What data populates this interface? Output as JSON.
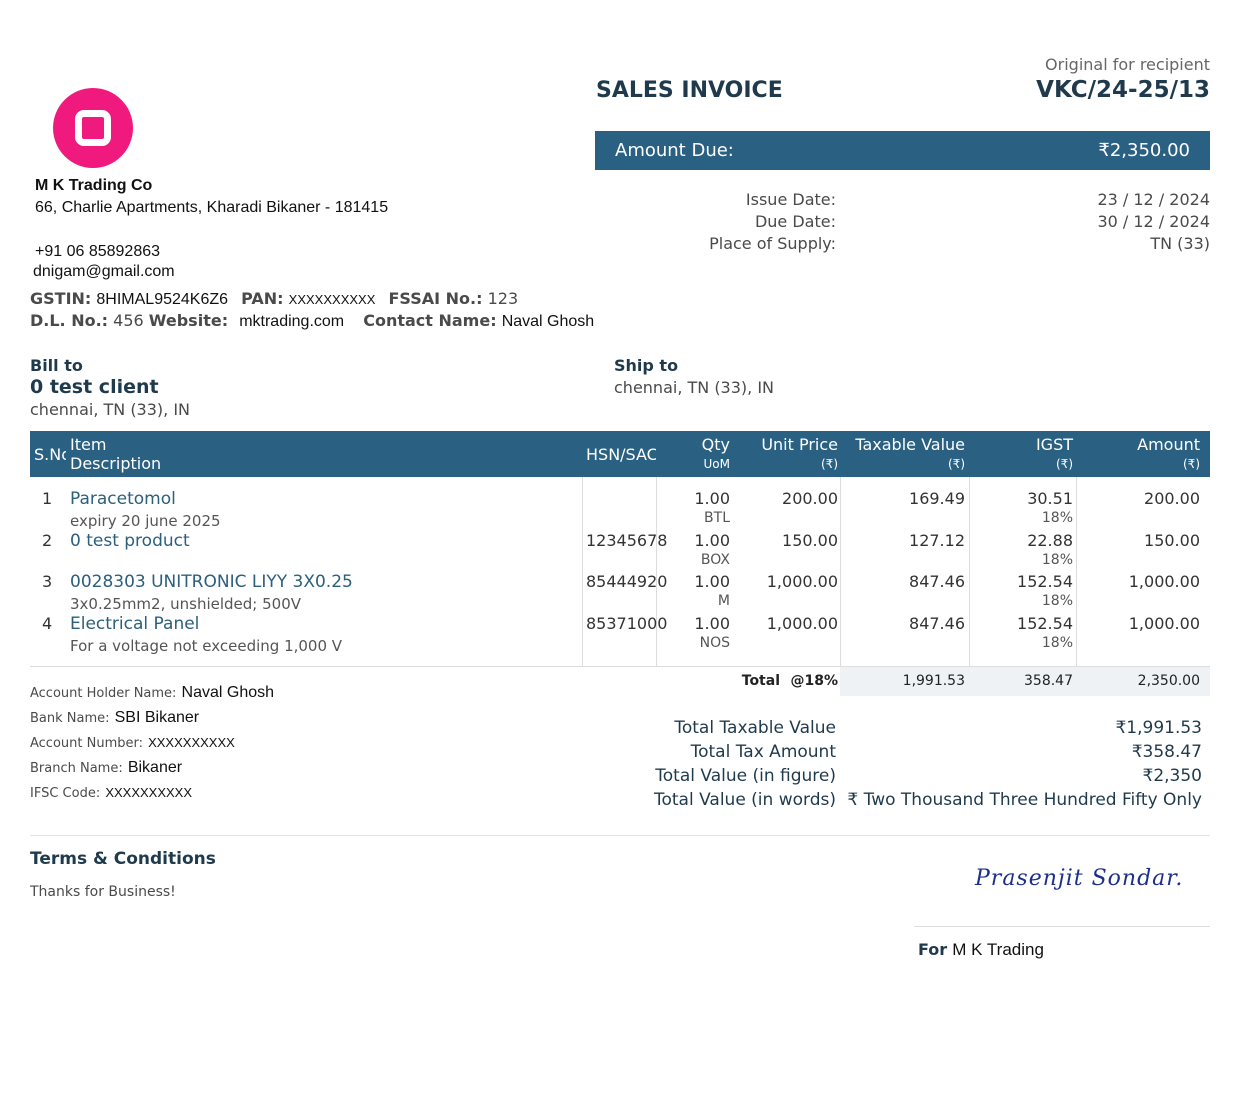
{
  "seller": {
    "name": "M K Trading Co",
    "address": "66, Charlie Apartments, Kharadi Bikaner - 181415",
    "phone": "+91 06 85892863",
    "email": "dnigam@gmail.com",
    "gstin_label": "GSTIN:",
    "gstin": "8HIMAL9524K6Z6",
    "pan_label": "PAN:",
    "pan": "XXXXXXXXXX",
    "fssai_label": "FSSAI No.:",
    "fssai": "123",
    "dl_label": "D.L. No.:",
    "dl": "456",
    "website_label": "Website:",
    "website": "mktrading.com",
    "contact_label": "Contact Name:",
    "contact": "Naval Ghosh"
  },
  "header": {
    "title": "SALES INVOICE",
    "copy_label": "Original for recipient",
    "invoice_number": "VKC/24-25/13",
    "amount_due_label": "Amount Due:",
    "amount_due": "₹2,350.00",
    "issue_date_label": "Issue Date:",
    "issue_date": "23 / 12 / 2024",
    "due_date_label": "Due Date:",
    "due_date": "30 / 12 / 2024",
    "place_label": "Place of Supply:",
    "place": "TN (33)"
  },
  "bill_to": {
    "label": "Bill to",
    "name": "0 test client",
    "address": "chennai, TN (33), IN"
  },
  "ship_to": {
    "label": "Ship to",
    "address": "chennai, TN (33), IN"
  },
  "table": {
    "headers": {
      "sno": "S.No",
      "item": "Item",
      "description": "Description",
      "hsn": "HSN/SAC",
      "qty": "Qty",
      "uom": "UoM",
      "unit_price": "Unit Price",
      "taxable": "Taxable Value",
      "igst": "IGST",
      "amount": "Amount",
      "currency": "(₹)"
    },
    "rows": [
      {
        "sno": "1",
        "name": "Paracetomol",
        "desc": "expiry 20 june 2025",
        "hsn": "",
        "qty": "1.00",
        "uom": "BTL",
        "unit_price": "200.00",
        "taxable": "169.49",
        "igst": "30.51",
        "rate": "18%",
        "amount": "200.00"
      },
      {
        "sno": "2",
        "name": "0 test product",
        "desc": "",
        "hsn": "12345678",
        "qty": "1.00",
        "uom": "BOX",
        "unit_price": "150.00",
        "taxable": "127.12",
        "igst": "22.88",
        "rate": "18%",
        "amount": "150.00"
      },
      {
        "sno": "3",
        "name": "0028303 UNITRONIC LIYY 3X0.25",
        "desc": "3x0.25mm2, unshielded; 500V",
        "hsn": "85444920",
        "qty": "1.00",
        "uom": "M",
        "unit_price": "1,000.00",
        "taxable": "847.46",
        "igst": "152.54",
        "rate": "18%",
        "amount": "1,000.00"
      },
      {
        "sno": "4",
        "name": "Electrical Panel",
        "desc": "For a voltage not exceeding 1,000 V",
        "hsn": "85371000",
        "qty": "1.00",
        "uom": "NOS",
        "unit_price": "1,000.00",
        "taxable": "847.46",
        "igst": "152.54",
        "rate": "18%",
        "amount": "1,000.00"
      }
    ],
    "total_label": "Total",
    "total_rate": "@18%",
    "total_taxable": "1,991.53",
    "total_igst": "358.47",
    "total_amount": "2,350.00"
  },
  "bank": {
    "holder_label": "Account Holder Name:",
    "holder": "Naval Ghosh",
    "bank_label": "Bank Name:",
    "bank": "SBI Bikaner",
    "account_label": "Account Number:",
    "account": "XXXXXXXXXX",
    "branch_label": "Branch Name:",
    "branch": "Bikaner",
    "ifsc_label": "IFSC Code:",
    "ifsc": "XXXXXXXXXX"
  },
  "totals": {
    "taxable_label": "Total Taxable Value",
    "taxable": "₹1,991.53",
    "tax_label": "Total Tax Amount",
    "tax": "₹358.47",
    "figure_label": "Total Value (in figure)",
    "figure": "₹2,350",
    "words_label": "Total Value (in words)",
    "words": "₹ Two Thousand Three Hundred Fifty Only"
  },
  "terms": {
    "title": "Terms & Conditions",
    "text": "Thanks for Business!"
  },
  "signature": {
    "text": "Prasenjit Sondar.",
    "for_label": "For",
    "for_name": "M K Trading"
  },
  "colors": {
    "header_bar": "#2a6183",
    "logo": "#f0197d",
    "item_name": "#2c5f7c"
  }
}
